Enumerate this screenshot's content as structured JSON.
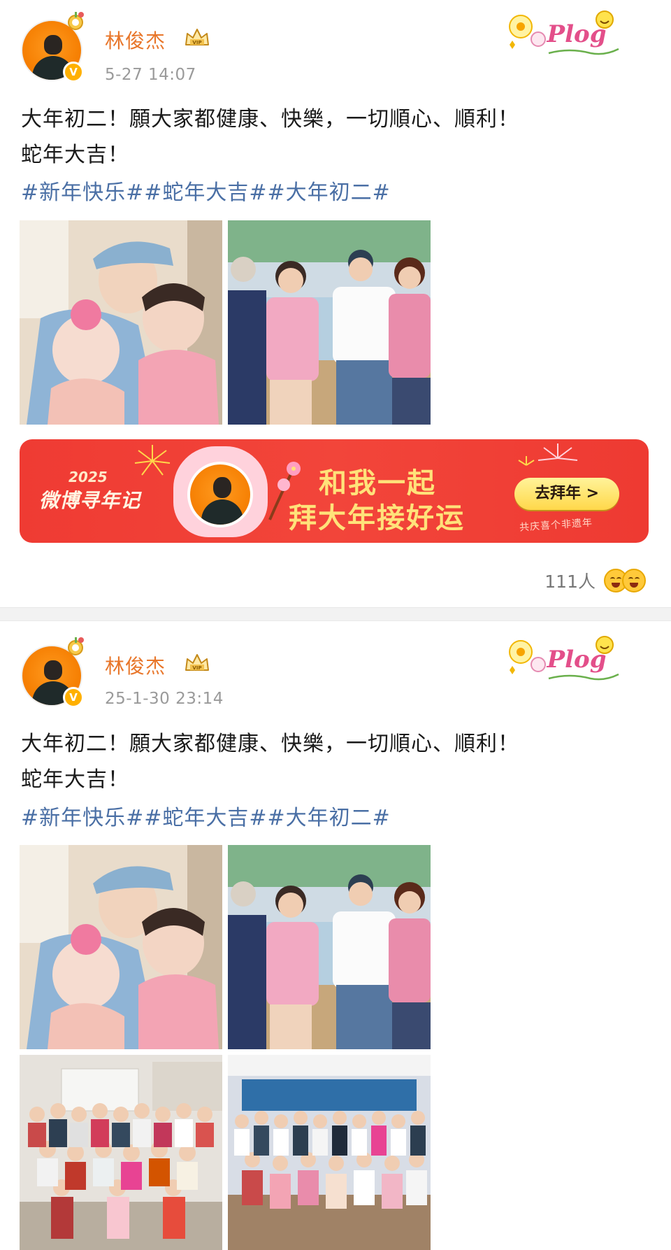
{
  "posts": [
    {
      "author": "林俊杰",
      "timestamp": "5-27 14:07",
      "text_lines": [
        "大年初二！願大家都健康、快樂，一切順心、順利！",
        "蛇年大吉！"
      ],
      "hashtags": "#新年快乐##蛇年大吉##大年初二#",
      "photos": [
        "photo-selfie-with-babies",
        "photo-family-four-on-sofa"
      ],
      "banner": {
        "year": "2025",
        "brand": "微博寻年记",
        "line1": "和我一起",
        "line2": "拜大年接好运",
        "cta": "去拜年 >",
        "sub": "共庆喜个非遗年"
      },
      "reactions_count": "111人"
    },
    {
      "author": "林俊杰",
      "timestamp": "25-1-30 23:14",
      "text_lines": [
        "大年初二！願大家都健康、快樂，一切順心、順利！",
        "蛇年大吉！"
      ],
      "hashtags": "#新年快乐##蛇年大吉##大年初二#",
      "photos": [
        "photo-selfie-with-babies",
        "photo-family-four-on-sofa",
        "photo-large-family-group",
        "photo-extended-family-living-room"
      ]
    }
  ],
  "sticker_text": "Plog",
  "colors": {
    "username": "#e8762a",
    "hashtag": "#4a6fa5",
    "banner_red": "#ef3b33",
    "cta_yellow": "#ffd84a"
  }
}
